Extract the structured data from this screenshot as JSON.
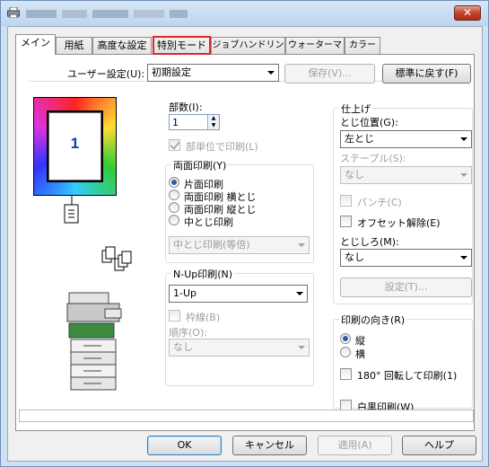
{
  "window": {
    "close_label": "✕"
  },
  "tabs": [
    {
      "label": "メイン"
    },
    {
      "label": "用紙"
    },
    {
      "label": "高度な設定"
    },
    {
      "label": "特別モード"
    },
    {
      "label": "ジョブハンドリング"
    },
    {
      "label": "ウォーターマーク"
    },
    {
      "label": "カラー"
    }
  ],
  "user_settings": {
    "label": "ユーザー設定(U):",
    "value": "初期設定",
    "save_label": "保存(V)...",
    "reset_label": "標準に戻す(F)"
  },
  "preview": {
    "page_number": "1"
  },
  "copies": {
    "label": "部数(I):",
    "value": "1",
    "collate_label": "部単位で印刷(L)"
  },
  "duplex": {
    "title": "両面印刷(Y)",
    "options": [
      "片面印刷",
      "両面印刷 横とじ",
      "両面印刷 縦とじ",
      "中とじ印刷"
    ],
    "selected": 0,
    "booklet_value": "中とじ印刷(等倍)"
  },
  "nup": {
    "title": "N-Up印刷(N)",
    "value": "1-Up",
    "border_label": "枠線(B)",
    "order_label": "順序(O):",
    "order_value": "なし"
  },
  "finishing": {
    "title": "仕上げ",
    "binding_label": "とじ位置(G):",
    "binding_value": "左とじ",
    "staple_label": "ステープル(S):",
    "staple_value": "なし",
    "punch_label": "パンチ(C)",
    "offset_label": "オフセット解除(E)",
    "margin_label": "とじしろ(M):",
    "margin_value": "なし",
    "settings_label": "設定(T)..."
  },
  "orientation": {
    "title": "印刷の向き(R)",
    "options": [
      "縦",
      "横"
    ],
    "selected": 0,
    "rotate_label": "180° 回転して印刷(1)"
  },
  "bw_print_label": "白黒印刷(W)",
  "footer": {
    "ok": "OK",
    "cancel": "キャンセル",
    "apply": "適用(A)",
    "help": "ヘルプ"
  },
  "colors": {
    "tab_highlight": "#e0262a",
    "radio_dot": "#2a5ea8"
  }
}
